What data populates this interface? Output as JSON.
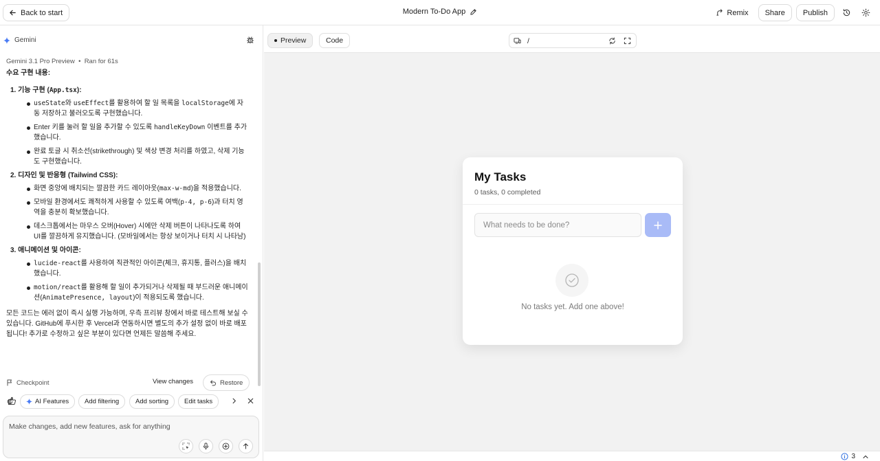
{
  "topbar": {
    "back_label": "Back to start",
    "app_title": "Modern To-Do App",
    "remix_label": "Remix",
    "share_label": "Share",
    "publish_label": "Publish"
  },
  "chat": {
    "assistant_name": "Gemini",
    "model_name": "Gemini 3.1 Pro Preview",
    "run_info": "Ran for 61s",
    "heading": "수요 구현 내용:",
    "sections": [
      {
        "title": "1. 기능 구현 (App.tsx):",
        "items": [
          [
            "",
            "useState",
            "와 ",
            "useEffect",
            "를 활용하여 할 일 목록을 ",
            "localStorage",
            "에 자동 저장하고 불러오도록 구현했습니다."
          ],
          [
            "Enter 키를 눌러 할 일을 추가할 수 있도록 ",
            "handleKeyDown",
            " 이벤트를 추가했습니다."
          ],
          [
            "완료 토글 시 취소선(strikethrough) 및 색상 변경 처리를 하였고, 삭제 기능도 구현했습니다."
          ]
        ]
      },
      {
        "title": "2. 디자인 및 반응형 (Tailwind CSS):",
        "items": [
          [
            "화면 중앙에 배치되는 깔끔한 카드 레이아웃(",
            "max-w-md",
            ")을 적용했습니다."
          ],
          [
            "모바일 환경에서도 쾌적하게 사용할 수 있도록 여백(",
            "p-4, p-6",
            ")과 터치 영역을 충분히 확보했습니다."
          ],
          [
            "데스크톱에서는 마우스 오버(Hover) 시에만 삭제 버튼이 나타나도록 하여 UI를 깔끔하게 유지했습니다. (모바일에서는 항상 보이거나 터치 시 나타남)"
          ]
        ]
      },
      {
        "title": "3. 애니메이션 및 아이콘:",
        "items": [
          [
            "",
            "lucide-react",
            "를 사용하여 직관적인 아이콘(체크, 휴지통, 플러스)을 배치했습니다."
          ],
          [
            "",
            "motion/react",
            "를 활용해 할 일이 추가되거나 삭제될 때 부드러운 애니메이션(",
            "AnimatePresence, layout",
            ")이 적용되도록 했습니다."
          ]
        ]
      }
    ],
    "closing": "모든 코드는 에러 없이 즉시 실행 가능하며, 우측 프리뷰 창에서 바로 테스트해 보실 수 있습니다. GitHub에 푸시한 후 Vercel과 연동하시면 별도의 추가 설정 없이 바로 배포됩니다! 추가로 수정하고 싶은 부분이 있다면 언제든 말씀해 주세요.",
    "checkpoint_label": "Checkpoint",
    "view_changes_label": "View changes",
    "restore_label": "Restore",
    "chips": [
      "AI Features",
      "Add filtering",
      "Add sorting",
      "Edit tasks"
    ],
    "composer_placeholder": "Make changes, add new features, ask for anything"
  },
  "preview": {
    "tabs": [
      "Preview",
      "Code"
    ],
    "active_tab": "Preview",
    "url_path": "/",
    "card": {
      "title": "My Tasks",
      "subtitle": "0 tasks, 0 completed",
      "input_placeholder": "What needs to be done?",
      "empty_text": "No tasks yet. Add one above!"
    },
    "issues_count": "3"
  },
  "colors": {
    "accent": "#a9bbf7",
    "gemini_blue": "#4a7cf5",
    "border": "#dcdcdc",
    "canvas": "#f2f2f2"
  }
}
